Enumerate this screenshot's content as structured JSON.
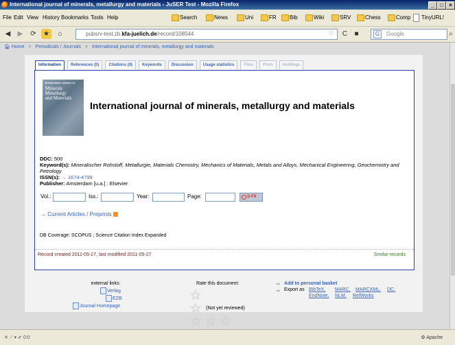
{
  "window": {
    "title": "International journal of minerals, metallurgy and materials - JuSER Test - Mozilla Firefox"
  },
  "menu": {
    "items": [
      "File",
      "Edit",
      "View",
      "History",
      "Bookmarks",
      "Tools",
      "Help"
    ],
    "bookmarks": [
      "Search",
      "News",
      "Uni",
      "FR",
      "Bib",
      "Wiki",
      "SRV",
      "Chess",
      "Comp",
      "TinyURL!"
    ]
  },
  "nav": {
    "url_prefix": "pubsrv-test.zb.",
    "url_domain": "kfa-juelich.de",
    "url_path": "/record/108544",
    "search_placeholder": "Google"
  },
  "breadcrumb": [
    "Home",
    "Periodicals / Journals",
    "International journal of minerals, metallurgy and materials"
  ],
  "tabs": [
    {
      "label": "Information",
      "state": "active"
    },
    {
      "label": "References (0)",
      "state": "normal"
    },
    {
      "label": "Citations (0)",
      "state": "normal"
    },
    {
      "label": "Keywords",
      "state": "normal"
    },
    {
      "label": "Discussion",
      "state": "normal"
    },
    {
      "label": "Usage statistics",
      "state": "normal"
    },
    {
      "label": "Files",
      "state": "disabled"
    },
    {
      "label": "Plots",
      "state": "disabled"
    },
    {
      "label": "Holdings",
      "state": "disabled"
    }
  ],
  "record": {
    "cover_header": "INTERNATIONAL JOURNAL OF",
    "cover_title_1": "Minerals",
    "cover_title_2": "Metallurgy",
    "cover_title_3": "and Materials",
    "title": "International journal of minerals, metallurgy and materials",
    "ddc_label": "DDC:",
    "ddc_value": "500",
    "keywords_label": "Keyword(s):",
    "keywords_value": "Mineralischer Rohstoff, Metallurgie, Materials Chemistry, Mechanics of Materials, Metals and Alloys, Mechanical Engineering, Geochemistry and Petrology",
    "issn_label": "ISSN(s):",
    "issn_value": "1674-4799",
    "publisher_label": "Publisher:",
    "publisher_value": "Amsterdam [u.a.] : Elsevier"
  },
  "form": {
    "vol": "Vol.:",
    "iss": "Iss.:",
    "year": "Year:",
    "page": "Page:",
    "sfx": "S·FX"
  },
  "current_articles": "Current Articles / Preprints",
  "coverage": "DB Coverage: SCOPUS ; Science Citation Index Expanded",
  "footer": {
    "created": "Record created 2011-05-27, last modified 2011-05-27",
    "similar": "Similar records"
  },
  "bottom": {
    "external_links_label": "external links:",
    "links": [
      "Verlag",
      "EZB",
      "Journal Homepage"
    ],
    "rate_label": "Rate this document:",
    "not_reviewed": "(Not yet reviewed)",
    "basket": "Add to personal basket",
    "export_label": "Export as",
    "exports": [
      "BibTeX,",
      "MARC,",
      "MARCXML,",
      "DC,",
      "EndNote,",
      "NLM,",
      "RefWorks"
    ]
  },
  "status": {
    "left": "0:0",
    "right": "Apache"
  }
}
